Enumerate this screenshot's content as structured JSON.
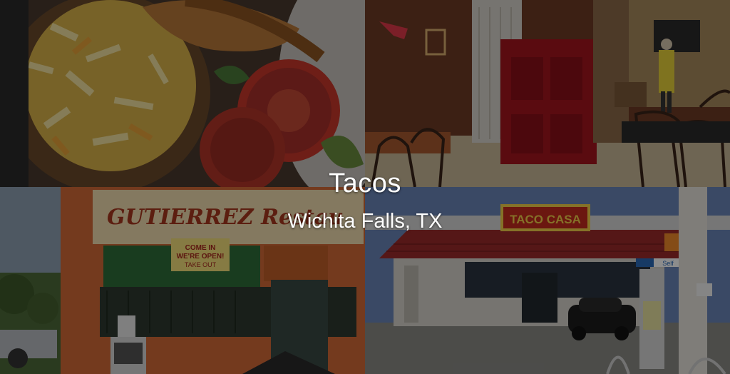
{
  "overlay": {
    "title": "Tacos",
    "subtitle": "Wichita Falls, TX"
  },
  "photos": {
    "food": {
      "icon": "taco-plate-photo"
    },
    "interior": {
      "icon": "restaurant-interior-photo"
    },
    "gutierrez": {
      "sign_text": "GUTIERREZ Restau",
      "notice_line1": "COME IN",
      "notice_line2": "WE'RE OPEN!",
      "notice_line3": "TAKE OUT"
    },
    "taco_casa": {
      "sign_text": "TACO CASA",
      "canopy_text": "Self"
    }
  },
  "colors": {
    "text": "#ffffff",
    "dim_overlay": "#000000"
  }
}
